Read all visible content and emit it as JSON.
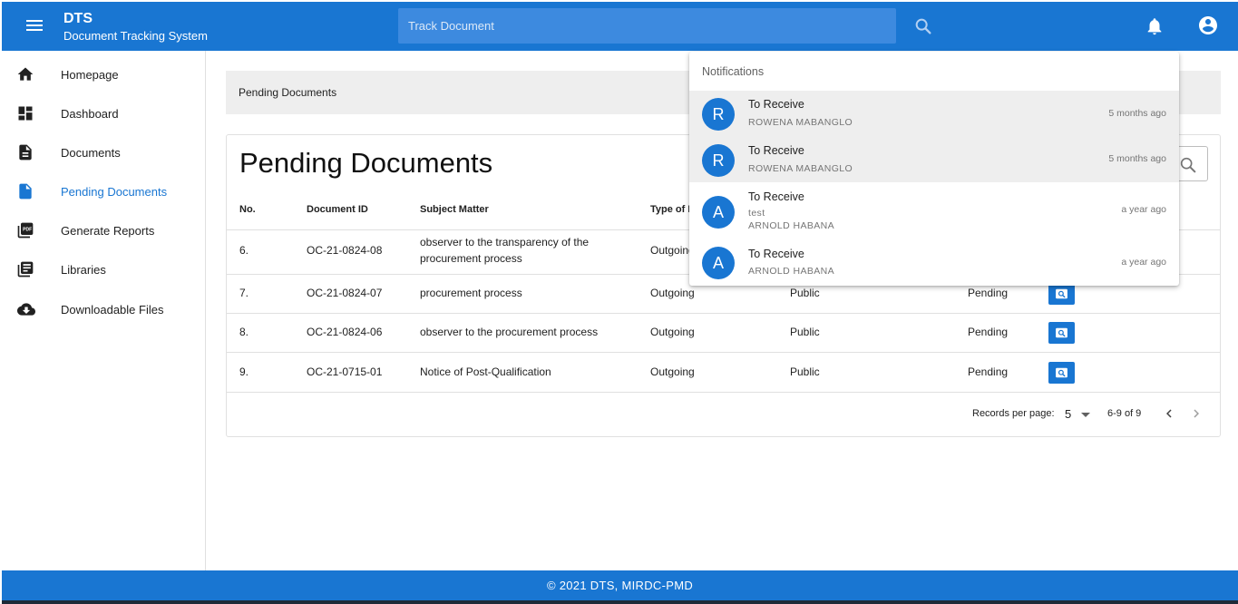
{
  "header": {
    "brand": "DTS",
    "subtitle": "Document Tracking System",
    "search_placeholder": "Track Document"
  },
  "sidebar": {
    "items": [
      {
        "label": "Homepage",
        "icon": "home-icon"
      },
      {
        "label": "Dashboard",
        "icon": "dashboard-icon"
      },
      {
        "label": "Documents",
        "icon": "document-icon"
      },
      {
        "label": "Pending Documents",
        "icon": "document-icon",
        "active": true
      },
      {
        "label": "Generate Reports",
        "icon": "pdf-icon"
      },
      {
        "label": "Libraries",
        "icon": "library-icon"
      },
      {
        "label": "Downloadable Files",
        "icon": "cloud-download-icon"
      }
    ]
  },
  "breadcrumb": "Pending Documents",
  "card": {
    "title": "Pending Documents",
    "columns": [
      "No.",
      "Document ID",
      "Subject Matter",
      "Type of D"
    ],
    "rows": [
      {
        "no": "6.",
        "id": "OC-21-0824-08",
        "subject_l1": "observer to the transparency of the",
        "subject_l2": "procurement process",
        "type": "Outgoing",
        "access": "",
        "status": ""
      },
      {
        "no": "7.",
        "id": "OC-21-0824-07",
        "subject": "procurement process",
        "type": "Outgoing",
        "access": "Public",
        "status": "Pending"
      },
      {
        "no": "8.",
        "id": "OC-21-0824-06",
        "subject": "observer to the procurement process",
        "type": "Outgoing",
        "access": "Public",
        "status": "Pending"
      },
      {
        "no": "9.",
        "id": "OC-21-0715-01",
        "subject": "Notice of Post-Qualification",
        "type": "Outgoing",
        "access": "Public",
        "status": "Pending"
      }
    ],
    "pagination": {
      "records_label": "Records per page:",
      "per_page": "5",
      "range": "6-9 of 9"
    }
  },
  "notifications": {
    "header": "Notifications",
    "items": [
      {
        "initial": "R",
        "title": "To Receive",
        "from": "ROWENA MABANGLO",
        "time": "5 months ago",
        "unread": true
      },
      {
        "initial": "R",
        "title": "To Receive",
        "from": "ROWENA MABANGLO",
        "time": "5 months ago",
        "unread": true
      },
      {
        "initial": "A",
        "title": "To Receive",
        "note": "test",
        "from": "ARNOLD HABANA",
        "time": "a year ago",
        "unread": false
      },
      {
        "initial": "A",
        "title": "To Receive",
        "from": "ARNOLD HABANA",
        "time": "a year ago",
        "unread": false
      }
    ]
  },
  "footer": "© 2021 DTS, MIRDC-PMD",
  "colors": {
    "primary": "#1976d2",
    "unread_bg": "#eeeeee"
  }
}
